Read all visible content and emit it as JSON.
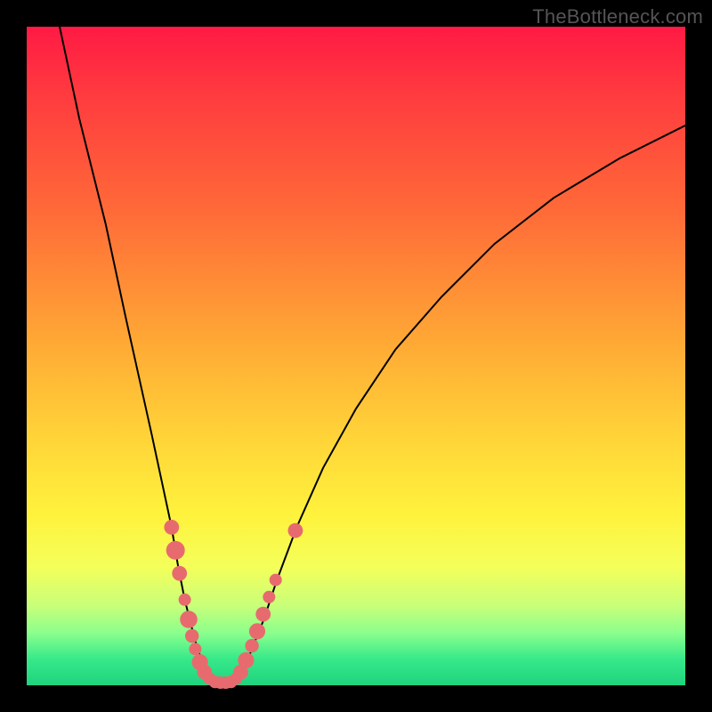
{
  "watermark": "TheBottleneck.com",
  "chart_data": {
    "type": "line",
    "title": "",
    "xlabel": "",
    "ylabel": "",
    "xlim": [
      0,
      100
    ],
    "ylim": [
      0,
      100
    ],
    "series": [
      {
        "name": "left-curve",
        "x": [
          5,
          8,
          12,
          15,
          17,
          19,
          20.5,
          22,
          23,
          24,
          25,
          25.8,
          26.5,
          27,
          27.5,
          28
        ],
        "values": [
          100,
          86,
          70,
          56,
          47,
          38,
          31,
          24,
          18,
          13,
          9,
          6,
          4,
          2.5,
          1.3,
          0.5
        ]
      },
      {
        "name": "right-curve",
        "x": [
          31.5,
          32.5,
          34,
          36,
          38,
          41,
          45,
          50,
          56,
          63,
          71,
          80,
          90,
          100
        ],
        "values": [
          0.5,
          2,
          5,
          10,
          16,
          24,
          33,
          42,
          51,
          59,
          67,
          74,
          80,
          85
        ]
      }
    ],
    "markers": [
      {
        "series": "left-curve",
        "x": 22.0,
        "y": 24.0,
        "r": 1.2
      },
      {
        "series": "left-curve",
        "x": 22.6,
        "y": 20.5,
        "r": 1.5
      },
      {
        "series": "left-curve",
        "x": 23.2,
        "y": 17.0,
        "r": 1.2
      },
      {
        "series": "left-curve",
        "x": 24.0,
        "y": 13.0,
        "r": 1.0
      },
      {
        "series": "left-curve",
        "x": 24.6,
        "y": 10.0,
        "r": 1.4
      },
      {
        "series": "left-curve",
        "x": 25.1,
        "y": 7.5,
        "r": 1.1
      },
      {
        "series": "left-curve",
        "x": 25.6,
        "y": 5.5,
        "r": 1.0
      },
      {
        "series": "left-curve",
        "x": 26.3,
        "y": 3.5,
        "r": 1.3
      },
      {
        "series": "left-curve",
        "x": 27.0,
        "y": 2.0,
        "r": 1.2
      },
      {
        "series": "left-curve",
        "x": 27.8,
        "y": 1.0,
        "r": 1.0
      },
      {
        "series": "valley",
        "x": 28.6,
        "y": 0.5,
        "r": 1.0
      },
      {
        "series": "valley",
        "x": 29.4,
        "y": 0.4,
        "r": 1.0
      },
      {
        "series": "valley",
        "x": 30.2,
        "y": 0.4,
        "r": 1.0
      },
      {
        "series": "valley",
        "x": 31.0,
        "y": 0.5,
        "r": 1.0
      },
      {
        "series": "right-curve",
        "x": 31.8,
        "y": 1.0,
        "r": 1.0
      },
      {
        "series": "right-curve",
        "x": 32.5,
        "y": 2.0,
        "r": 1.2
      },
      {
        "series": "right-curve",
        "x": 33.3,
        "y": 3.8,
        "r": 1.3
      },
      {
        "series": "right-curve",
        "x": 34.2,
        "y": 6.0,
        "r": 1.1
      },
      {
        "series": "right-curve",
        "x": 35.0,
        "y": 8.2,
        "r": 1.3
      },
      {
        "series": "right-curve",
        "x": 35.9,
        "y": 10.8,
        "r": 1.2
      },
      {
        "series": "right-curve",
        "x": 36.8,
        "y": 13.4,
        "r": 1.0
      },
      {
        "series": "right-curve",
        "x": 37.8,
        "y": 16.0,
        "r": 1.0
      },
      {
        "series": "right-curve",
        "x": 40.8,
        "y": 23.5,
        "r": 1.2
      }
    ],
    "marker_color": "#e76b6e",
    "curve_color": "#000000"
  }
}
